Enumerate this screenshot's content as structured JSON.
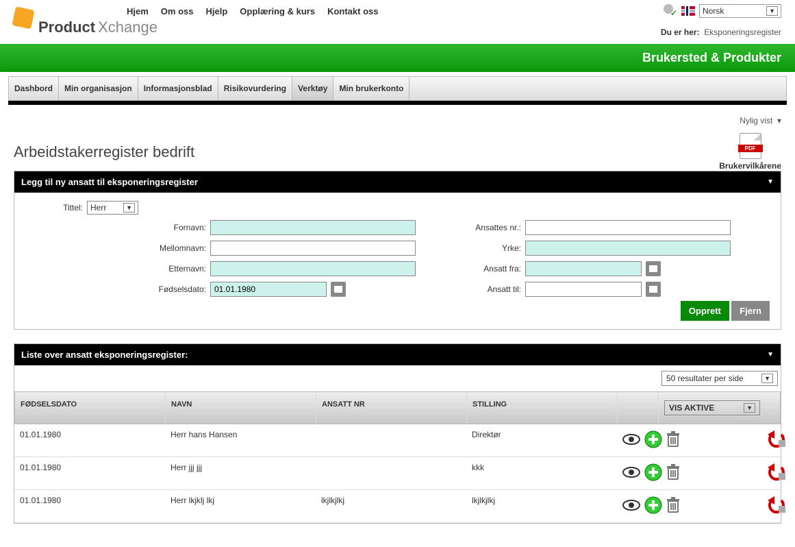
{
  "nav": {
    "items": [
      "Hjem",
      "Om oss",
      "Hjelp",
      "Opplæring & kurs",
      "Kontakt oss"
    ]
  },
  "language": {
    "selected": "Norsk"
  },
  "logo": {
    "part1": "Product",
    "part2": "Xchange"
  },
  "breadcrumb": {
    "label": "Du er her:",
    "value": "Eksponeringsregister"
  },
  "green_bar": {
    "title": "Brukersted & Produkter"
  },
  "main_tabs": [
    "Dashbord",
    "Min organisasjon",
    "Informasjonsblad",
    "Risikovurdering",
    "Verktøy",
    "Min brukerkonto"
  ],
  "recent": {
    "label": "Nylig vist"
  },
  "page_title": "Arbeidstakerregister bedrift",
  "pdf": {
    "label": "Brukervilkårene"
  },
  "form": {
    "heading": "Legg til ny ansatt til eksponeringsregister",
    "labels": {
      "tittel": "Tittel:",
      "fornavn": "Fornavn:",
      "mellomnavn": "Mellomnavn:",
      "etternavn": "Etternavn:",
      "fodselsdato": "Fødselsdato:",
      "ansattes_nr": "Ansattes nr.:",
      "yrke": "Yrke:",
      "ansatt_fra": "Ansatt fra:",
      "ansatt_til": "Ansatt til:"
    },
    "values": {
      "tittel": "Herr",
      "fornavn": "",
      "mellomnavn": "",
      "etternavn": "",
      "fodselsdato": "01.01.1980",
      "ansattes_nr": "",
      "yrke": "",
      "ansatt_fra": "",
      "ansatt_til": ""
    },
    "buttons": {
      "create": "Opprett",
      "clear": "Fjern"
    }
  },
  "list": {
    "heading": "Liste over ansatt eksponeringsregister:",
    "results_per_page": "50 resultater per side",
    "columns": {
      "dob": "FØDSELSDATO",
      "name": "NAVN",
      "empno": "ANSATT NR",
      "pos": "STILLING",
      "vis": "VIS AKTIVE"
    },
    "rows": [
      {
        "dob": "01.01.1980",
        "name": "Herr hans Hansen",
        "empno": "",
        "pos": "Direktør"
      },
      {
        "dob": "01.01.1980",
        "name": "Herr jjj jjj",
        "empno": "",
        "pos": "kkk"
      },
      {
        "dob": "01.01.1980",
        "name": "Herr lkjklj lkj",
        "empno": "lkjlkjlkj",
        "pos": "lkjlkjlkj"
      }
    ]
  }
}
